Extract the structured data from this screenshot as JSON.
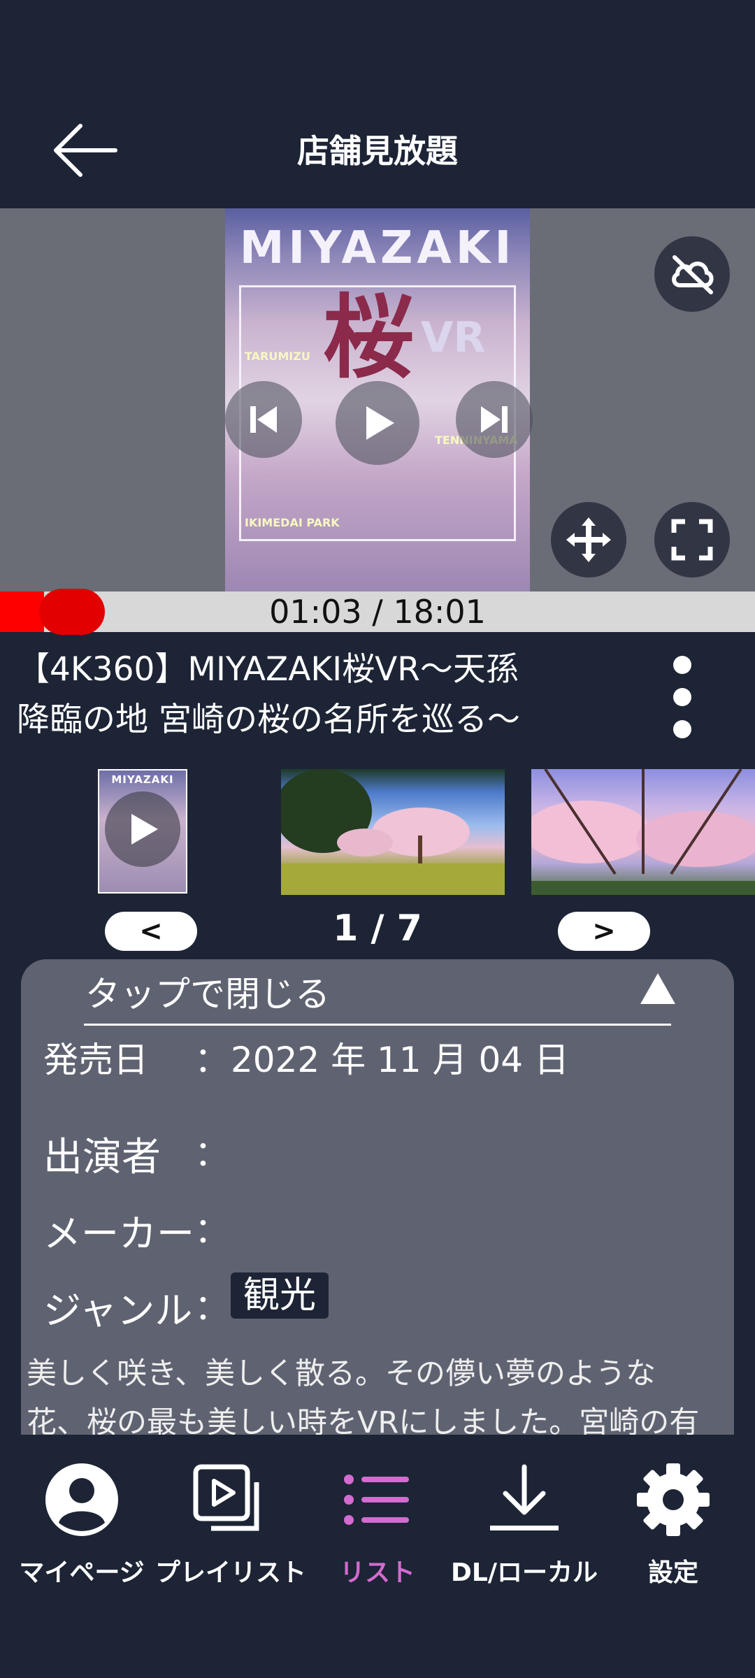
{
  "header": {
    "title": "店舗見放題"
  },
  "player": {
    "poster_title": "MIYAZAKI",
    "poster_kanji": "桜",
    "poster_vr": "VR",
    "poster_tags": [
      "TARUMIZU",
      "TENNINYAMA",
      "IKIMEDAI PARK"
    ],
    "time": "01:03 / 18:01",
    "progress_fraction": 0.058
  },
  "video": {
    "title_line1": "【4K360】MIYAZAKI桜VR〜天孫",
    "title_line2": "降臨の地 宮崎の桜の名所を巡る〜"
  },
  "thumbnails": {
    "first_title": "MIYAZAKI",
    "prev_label": "<",
    "next_label": ">",
    "page": "1 / 7"
  },
  "details": {
    "close_label": "タップで閉じる",
    "release_label": "発売日",
    "release_value": "2022 年 11 月 04 日",
    "cast_label": "出演者",
    "maker_label": "メーカー",
    "genre_label": "ジャンル",
    "colon": "：",
    "genre_value": "観光",
    "description_line1": "美しく咲き、美しく散る。その儚い夢のような",
    "description_line2": "花、桜の最も美しい時をVRにしました。宮崎の有"
  },
  "bottom_nav": {
    "items": [
      {
        "label": "マイページ",
        "icon": "person-icon"
      },
      {
        "label": "プレイリスト",
        "icon": "playlist-icon"
      },
      {
        "label": "リスト",
        "icon": "list-icon",
        "active": true
      },
      {
        "label": "DL/ローカル",
        "icon": "download-icon"
      },
      {
        "label": "設定",
        "icon": "gear-icon"
      }
    ],
    "active_color": "#d36bd0"
  },
  "colors": {
    "background": "#1c2435",
    "video_bg": "#6a6d76",
    "panel": "#5f6371",
    "progress_fill": "#ff0000"
  }
}
